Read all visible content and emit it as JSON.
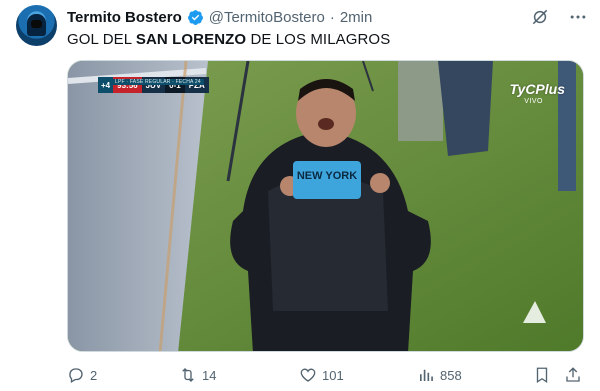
{
  "author": {
    "display_name": "Termito Bostero",
    "handle": "@TermitoBostero",
    "separator": "·",
    "time": "2min",
    "verified": true
  },
  "tweet": {
    "text_before": "GOL DEL ",
    "text_bold": "SAN LORENZO",
    "text_after": " DE LOS MILAGROS"
  },
  "media": {
    "scorebug": {
      "header": "LPF · FASE REGULAR · FECHA 24",
      "added_time": "+4",
      "clock": "93:56",
      "home_team": "JUV",
      "score": "0-1",
      "away_team": "PZA"
    },
    "broadcaster": "TyCPlus",
    "broadcaster_sub": "VIVO",
    "shirt_text": "NEW YORK"
  },
  "actions": {
    "replies": "2",
    "retweets": "14",
    "likes": "101",
    "views": "858"
  },
  "colors": {
    "accent": "#1d9bf0",
    "muted": "#536471",
    "text": "#0f1419"
  }
}
